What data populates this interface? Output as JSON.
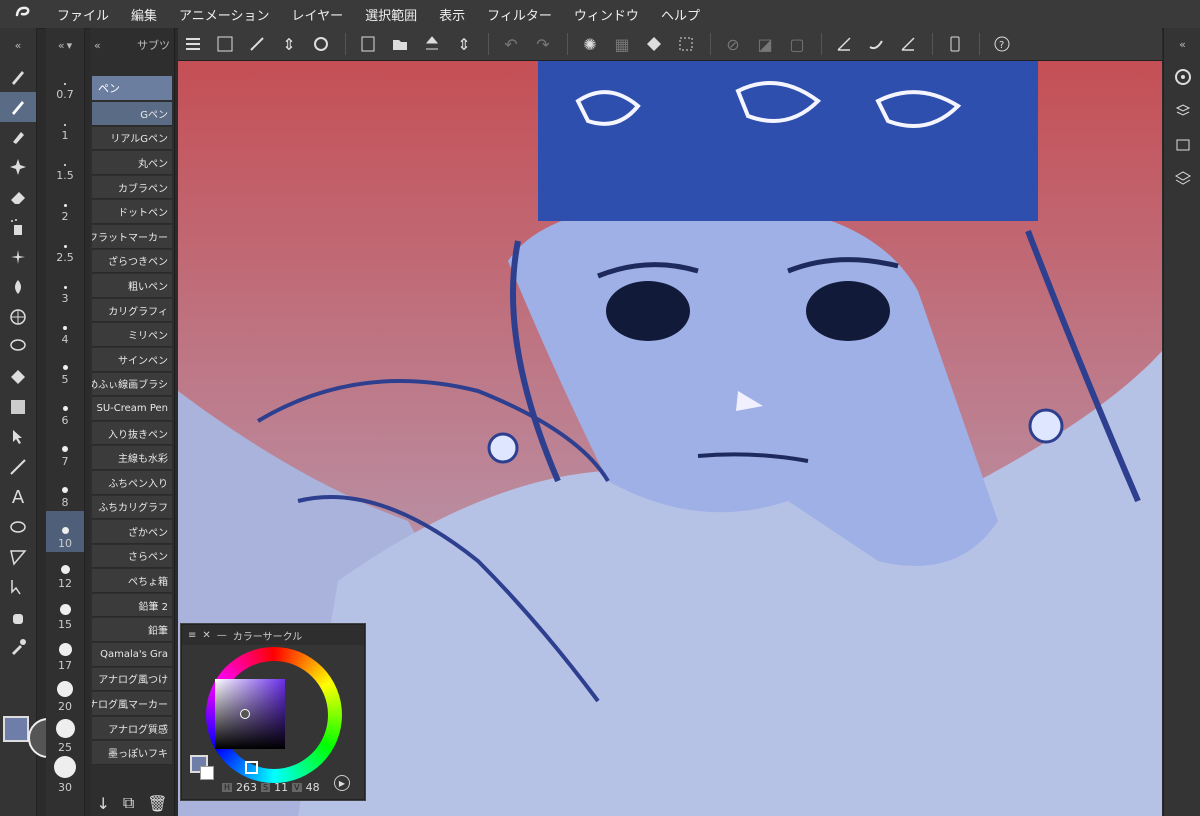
{
  "menu": [
    "ファイル",
    "編集",
    "アニメーション",
    "レイヤー",
    "選択範囲",
    "表示",
    "フィルター",
    "ウィンドウ",
    "ヘルプ"
  ],
  "sizes": [
    "0.7",
    "1",
    "1.5",
    "2",
    "2.5",
    "3",
    "4",
    "5",
    "6",
    "7",
    "8",
    "10",
    "12",
    "15",
    "17",
    "20",
    "25",
    "30"
  ],
  "active_size": "10",
  "brush_tab": "ペン",
  "brush_header": "サブツ",
  "brushes": [
    "Gペン",
    "リアルGペン",
    "丸ペン",
    "カブラペン",
    "ドットペン",
    "フラットマーカー",
    "ざらつきペン",
    "粗いペン",
    "カリグラフィ",
    "ミリペン",
    "サインペン",
    "めふぃ線画ブラシ",
    "SU-Cream Pen",
    "入り抜きペン",
    "主線も水彩",
    "ふちペン入り",
    "ふちカリグラフ",
    "ざかペン",
    "さらペン",
    "ぺちょ箱",
    "鉛筆 2",
    "鉛筆",
    "Qamala's Gra",
    "アナログ風つけ",
    "アナログ風マーカー",
    "アナログ質感",
    "墨っぽいフキ"
  ],
  "active_brush": "Gペン",
  "color_panel": {
    "title": "カラーサークル",
    "h_label": "H",
    "h": "263",
    "s_label": "S",
    "s": "11",
    "v_label": "V",
    "v": "48",
    "fg_color": "#6f7ea8"
  },
  "icons": {
    "tools": [
      "pen-icon",
      "g-pen-icon",
      "marker-icon",
      "effect-icon",
      "eraser-icon",
      "airbrush-icon",
      "decoration-icon",
      "blend-icon",
      "perspective-icon",
      "lasso-icon",
      "fill-icon",
      "gradient-icon",
      "operation-icon",
      "line-icon",
      "text-icon",
      "ellipse-icon",
      "polyline-icon",
      "move-icon",
      "hand-icon",
      "eyedropper-icon"
    ],
    "right": [
      "navigator-icon",
      "material-icon",
      "subview-icon",
      "layer-icon"
    ]
  }
}
